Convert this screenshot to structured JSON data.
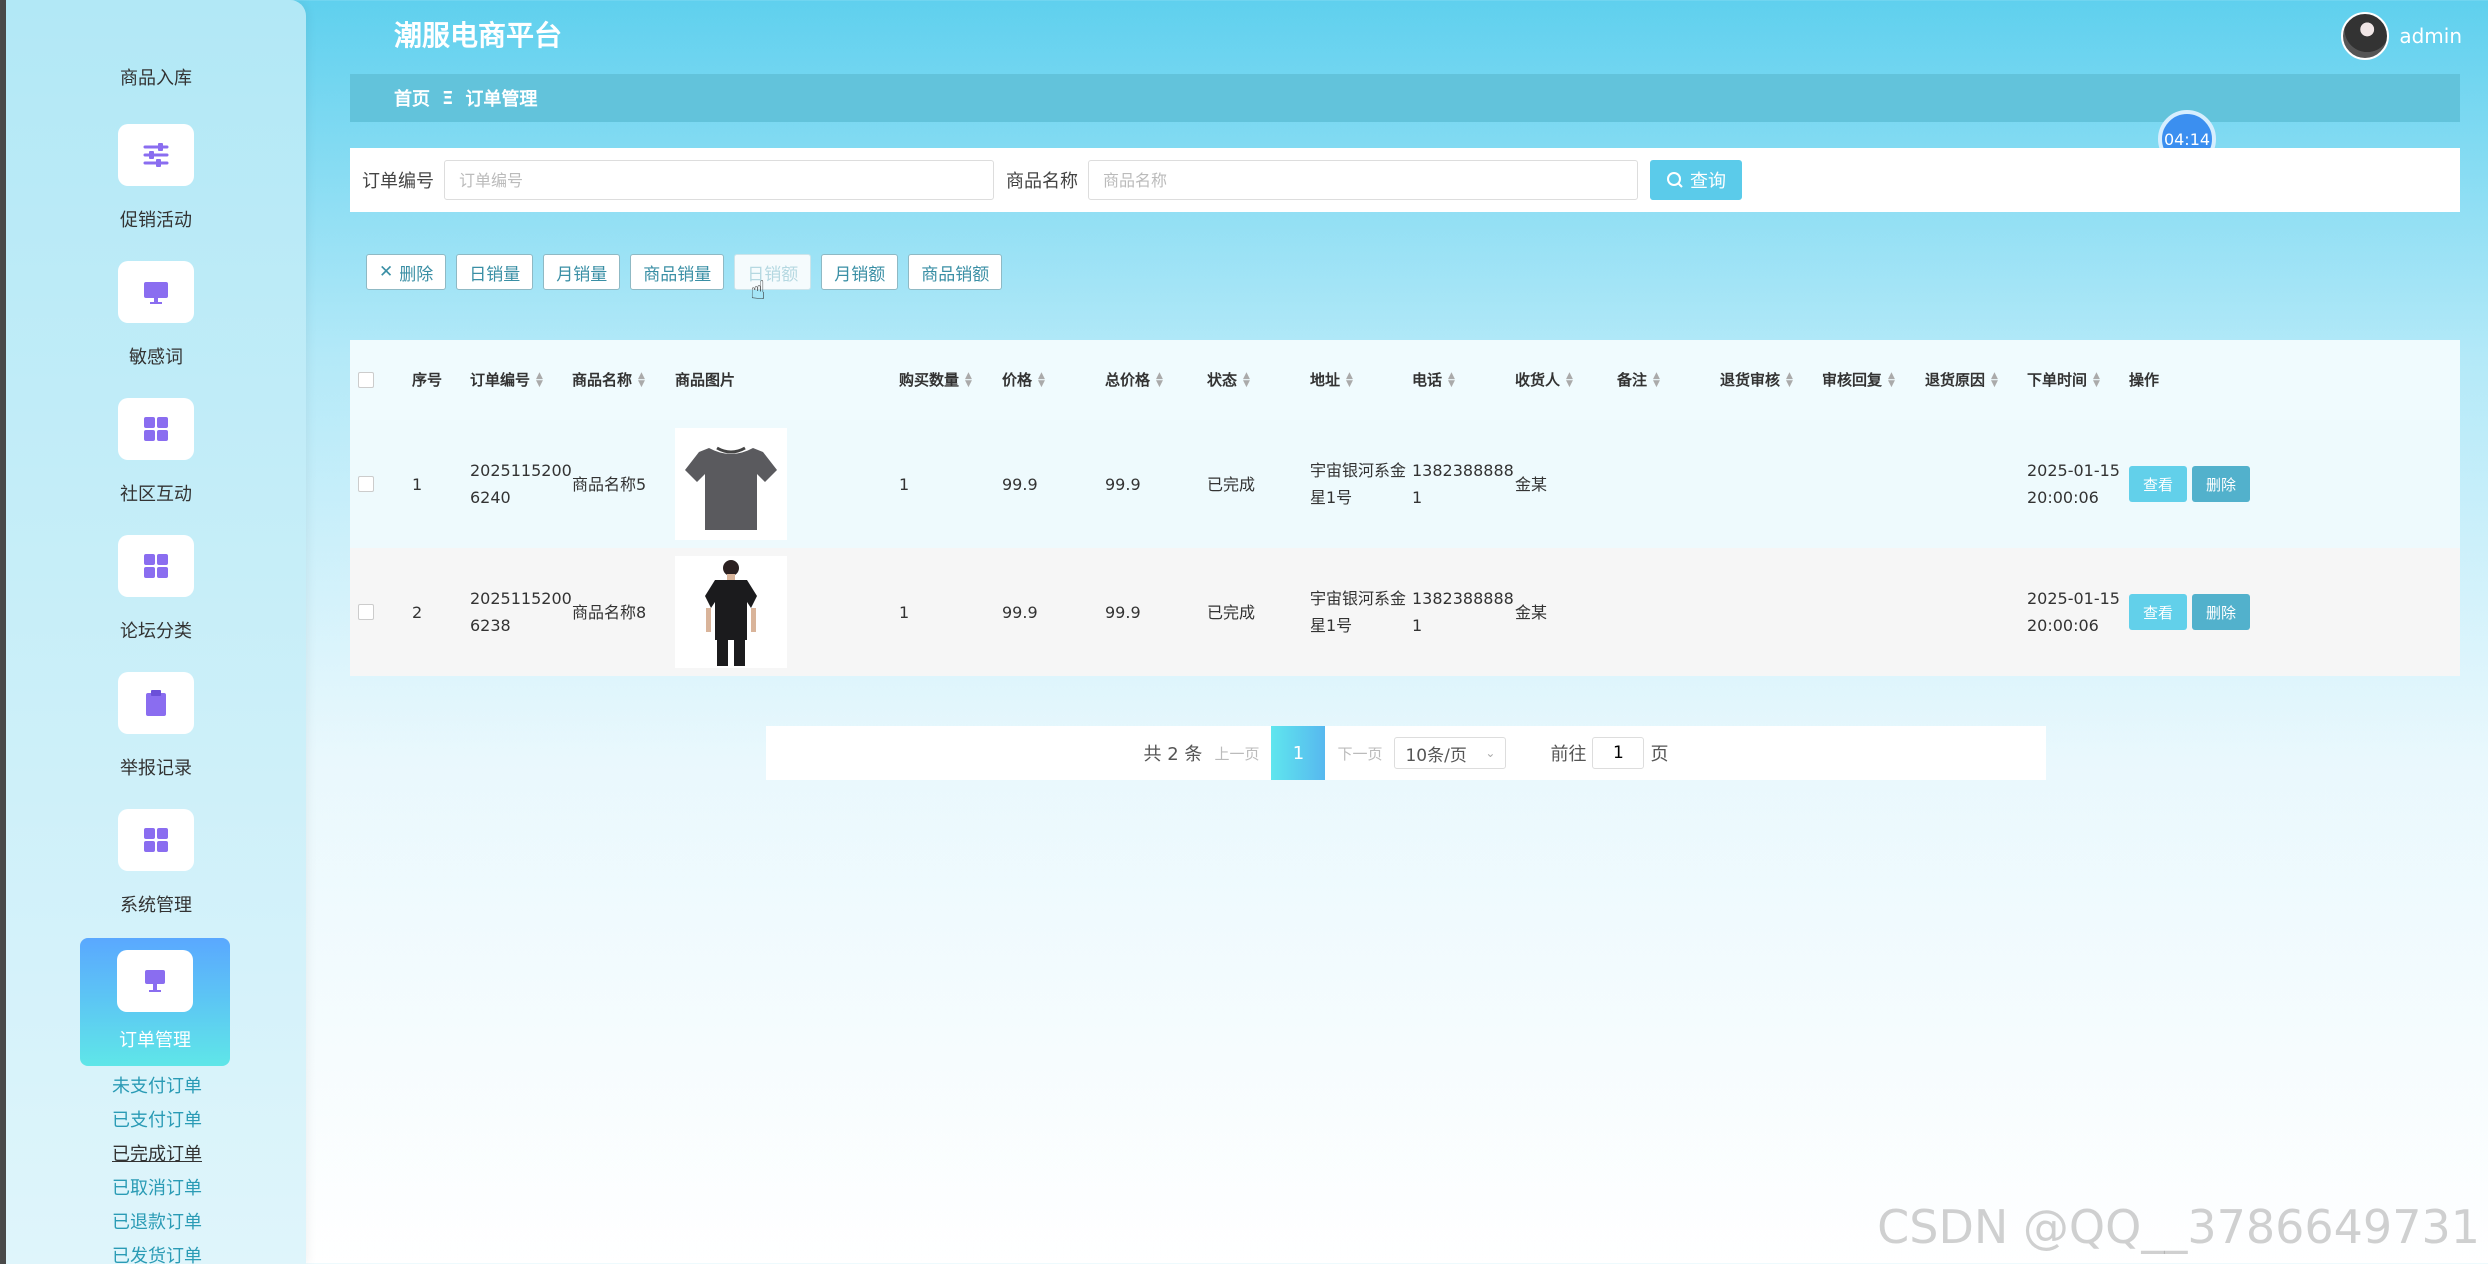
{
  "app": {
    "title": "潮服电商平台",
    "username": "admin"
  },
  "sidebar": {
    "first_label": "商品入库",
    "items": [
      {
        "label": "促销活动",
        "icon": "sliders-icon"
      },
      {
        "label": "敏感词",
        "icon": "monitor-icon"
      },
      {
        "label": "社区互动",
        "icon": "grid-icon"
      },
      {
        "label": "论坛分类",
        "icon": "grid-icon"
      },
      {
        "label": "举报记录",
        "icon": "clipboard-icon"
      },
      {
        "label": "系统管理",
        "icon": "grid-icon"
      }
    ],
    "active": {
      "label": "订单管理",
      "icon": "board-icon"
    },
    "sub_items": [
      "未支付订单",
      "已支付订单",
      "已完成订单",
      "已取消订单",
      "已退款订单",
      "已发货订单"
    ]
  },
  "breadcrumb": {
    "home": "首页",
    "sep": "Ξ",
    "current": "订单管理"
  },
  "timer": "04:14",
  "search": {
    "order_label": "订单编号",
    "order_placeholder": "订单编号",
    "product_label": "商品名称",
    "product_placeholder": "商品名称",
    "button": "查询"
  },
  "actions": [
    "删除",
    "日销量",
    "月销量",
    "商品销量",
    "日销额",
    "月销额",
    "商品销额"
  ],
  "table": {
    "headers": [
      "序号",
      "订单编号",
      "商品名称",
      "商品图片",
      "购买数量",
      "价格",
      "总价格",
      "状态",
      "地址",
      "电话",
      "收货人",
      "备注",
      "退货审核",
      "审核回复",
      "退货原因",
      "下单时间",
      "操作"
    ],
    "rows": [
      {
        "no": "1",
        "order_id": "2025115200\n6240",
        "name": "商品名称5",
        "qty": "1",
        "price": "99.9",
        "total": "99.9",
        "status": "已完成",
        "address": "宇宙银河系金\n星1号",
        "phone": "1382388888\n1",
        "receiver": "金某",
        "time": "2025-01-15\n20:00:06"
      },
      {
        "no": "2",
        "order_id": "2025115200\n6238",
        "name": "商品名称8",
        "qty": "1",
        "price": "99.9",
        "total": "99.9",
        "status": "已完成",
        "address": "宇宙银河系金\n星1号",
        "phone": "1382388888\n1",
        "receiver": "金某",
        "time": "2025-01-15\n20:00:06"
      }
    ],
    "view_label": "查看",
    "delete_label": "删除"
  },
  "pager": {
    "total": "共 2 条",
    "prev": "上一页",
    "page": "1",
    "next": "下一页",
    "size": "10条/页",
    "goto": "前往",
    "goto_value": "1",
    "unit": "页"
  },
  "watermark": "CSDN @QQ__3786649731"
}
